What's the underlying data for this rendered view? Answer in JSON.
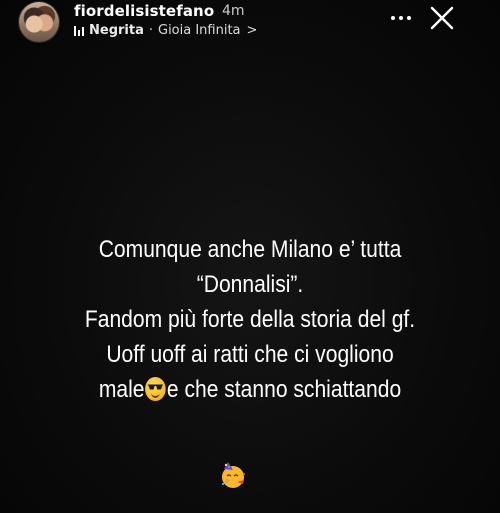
{
  "header": {
    "username": "fiordelisistefano",
    "time": "4m",
    "music": {
      "artist": "Negrita",
      "separator": "·",
      "song": "Gioia Infinita",
      "chevron": ">"
    }
  },
  "caption": {
    "line1": "Comunque anche Milano e’ tutta",
    "line2": "“Donnalisi”.",
    "line3": "Fandom più forte della storia del gf.",
    "line4": "Uoff uoff ai ratti che ci vogliono",
    "line5_before": "male",
    "line5_after": "e che stanno schiattando"
  },
  "icons": {
    "avatar": "profile-photo",
    "music": "music-bars-icon",
    "more": "more-dots-icon",
    "close": "close-x-icon",
    "emoji_inline": "sunglasses-face-emoji",
    "emoji_bottom": "partying-face-emoji"
  },
  "colors": {
    "background": "#0a0a0a",
    "text": "#ffffff",
    "emoji_yellow": "#f6b92b"
  }
}
